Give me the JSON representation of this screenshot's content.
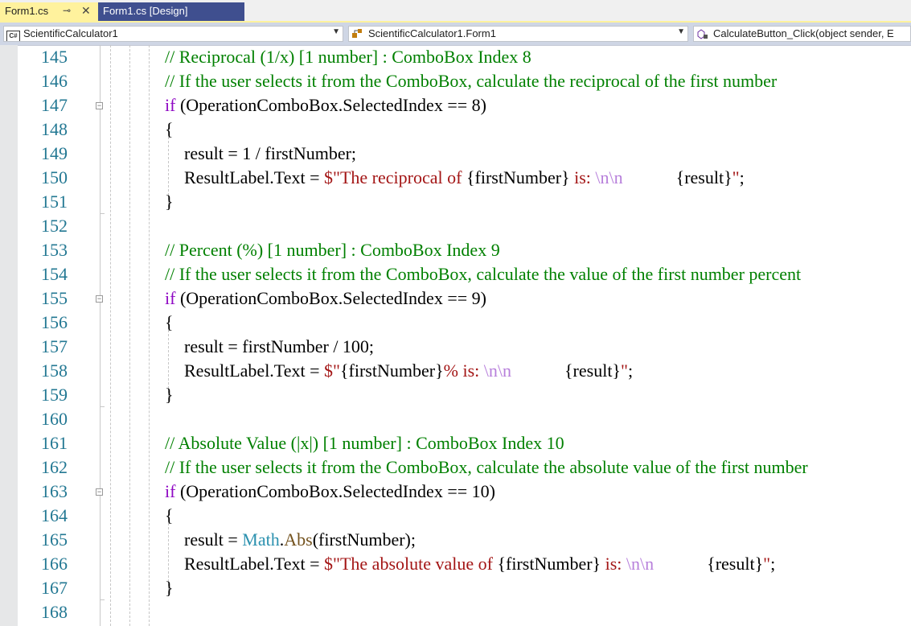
{
  "tabs": [
    {
      "label": "Form1.cs",
      "active": true
    },
    {
      "label": "Form1.cs [Design]",
      "active": false
    }
  ],
  "icons": {
    "pin": "pin-icon",
    "close": "close-icon"
  },
  "nav": {
    "project": "ScientificCalculator1",
    "class": "ScientificCalculator1.Form1",
    "member": "CalculateButton_Click(object sender, E"
  },
  "lines": [
    {
      "num": "145",
      "indent": 0,
      "tokens": [
        {
          "c": "cm",
          "t": "// Reciprocal (1/x) [1 number] : ComboBox Index 8"
        }
      ]
    },
    {
      "num": "146",
      "indent": 0,
      "tokens": [
        {
          "c": "cm",
          "t": "// If the user selects it from the ComboBox, calculate the reciprocal of the first number"
        }
      ]
    },
    {
      "num": "147",
      "indent": 0,
      "fold": true,
      "tokens": [
        {
          "c": "kw",
          "t": "if"
        },
        {
          "c": "",
          "t": " (OperationComboBox.SelectedIndex == 8)"
        }
      ]
    },
    {
      "num": "148",
      "indent": 0,
      "tokens": [
        {
          "c": "",
          "t": "{"
        }
      ]
    },
    {
      "num": "149",
      "indent": 1,
      "tokens": [
        {
          "c": "",
          "t": "result = 1 / firstNumber;"
        }
      ]
    },
    {
      "num": "150",
      "indent": 1,
      "tokens": [
        {
          "c": "",
          "t": "ResultLabel.Text = "
        },
        {
          "c": "str",
          "t": "$\"The reciprocal of "
        },
        {
          "c": "",
          "t": "{firstNumber}"
        },
        {
          "c": "str",
          "t": " is: "
        },
        {
          "c": "esc",
          "t": "\\n\\n"
        },
        {
          "c": "str",
          "t": "            "
        },
        {
          "c": "",
          "t": "{result}"
        },
        {
          "c": "str",
          "t": "\""
        },
        {
          "c": "",
          "t": ";"
        }
      ]
    },
    {
      "num": "151",
      "indent": 0,
      "tokens": [
        {
          "c": "",
          "t": "}"
        }
      ]
    },
    {
      "num": "152",
      "indent": 0,
      "tokens": []
    },
    {
      "num": "153",
      "indent": 0,
      "tokens": [
        {
          "c": "cm",
          "t": "// Percent (%) [1 number] : ComboBox Index 9"
        }
      ]
    },
    {
      "num": "154",
      "indent": 0,
      "tokens": [
        {
          "c": "cm",
          "t": "// If the user selects it from the ComboBox, calculate the value of the first number percent"
        }
      ]
    },
    {
      "num": "155",
      "indent": 0,
      "fold": true,
      "tokens": [
        {
          "c": "kw",
          "t": "if"
        },
        {
          "c": "",
          "t": " (OperationComboBox.SelectedIndex == 9)"
        }
      ]
    },
    {
      "num": "156",
      "indent": 0,
      "tokens": [
        {
          "c": "",
          "t": "{"
        }
      ]
    },
    {
      "num": "157",
      "indent": 1,
      "tokens": [
        {
          "c": "",
          "t": "result = firstNumber / 100;"
        }
      ]
    },
    {
      "num": "158",
      "indent": 1,
      "tokens": [
        {
          "c": "",
          "t": "ResultLabel.Text = "
        },
        {
          "c": "str",
          "t": "$\""
        },
        {
          "c": "",
          "t": "{firstNumber}"
        },
        {
          "c": "str",
          "t": "% is: "
        },
        {
          "c": "esc",
          "t": "\\n\\n"
        },
        {
          "c": "str",
          "t": "            "
        },
        {
          "c": "",
          "t": "{result}"
        },
        {
          "c": "str",
          "t": "\""
        },
        {
          "c": "",
          "t": ";"
        }
      ]
    },
    {
      "num": "159",
      "indent": 0,
      "tokens": [
        {
          "c": "",
          "t": "}"
        }
      ]
    },
    {
      "num": "160",
      "indent": 0,
      "tokens": []
    },
    {
      "num": "161",
      "indent": 0,
      "tokens": [
        {
          "c": "cm",
          "t": "// Absolute Value (|x|) [1 number] : ComboBox Index 10"
        }
      ]
    },
    {
      "num": "162",
      "indent": 0,
      "tokens": [
        {
          "c": "cm",
          "t": "// If the user selects it from the ComboBox, calculate the absolute value of the first number"
        }
      ]
    },
    {
      "num": "163",
      "indent": 0,
      "fold": true,
      "tokens": [
        {
          "c": "kw",
          "t": "if"
        },
        {
          "c": "",
          "t": " (OperationComboBox.SelectedIndex == 10)"
        }
      ]
    },
    {
      "num": "164",
      "indent": 0,
      "tokens": [
        {
          "c": "",
          "t": "{"
        }
      ]
    },
    {
      "num": "165",
      "indent": 1,
      "tokens": [
        {
          "c": "",
          "t": "result = "
        },
        {
          "c": "typ",
          "t": "Math"
        },
        {
          "c": "",
          "t": "."
        },
        {
          "c": "mth",
          "t": "Abs"
        },
        {
          "c": "",
          "t": "(firstNumber);"
        }
      ]
    },
    {
      "num": "166",
      "indent": 1,
      "tokens": [
        {
          "c": "",
          "t": "ResultLabel.Text = "
        },
        {
          "c": "str",
          "t": "$\"The absolute value of "
        },
        {
          "c": "",
          "t": "{firstNumber}"
        },
        {
          "c": "str",
          "t": " is: "
        },
        {
          "c": "esc",
          "t": "\\n\\n"
        },
        {
          "c": "str",
          "t": "            "
        },
        {
          "c": "",
          "t": "{result}"
        },
        {
          "c": "str",
          "t": "\""
        },
        {
          "c": "",
          "t": ";"
        }
      ]
    },
    {
      "num": "167",
      "indent": 0,
      "tokens": [
        {
          "c": "",
          "t": "}"
        }
      ]
    },
    {
      "num": "168",
      "indent": 0,
      "tokens": []
    }
  ],
  "colors": {
    "comment": "#008000",
    "keyword": "#8f08c4",
    "string": "#a31515",
    "escape": "#b77fdb",
    "type": "#2b91af",
    "method": "#74531f",
    "line_number": "#237893",
    "active_tab": "#fff29d",
    "inactive_tab": "#3f4f8f"
  }
}
